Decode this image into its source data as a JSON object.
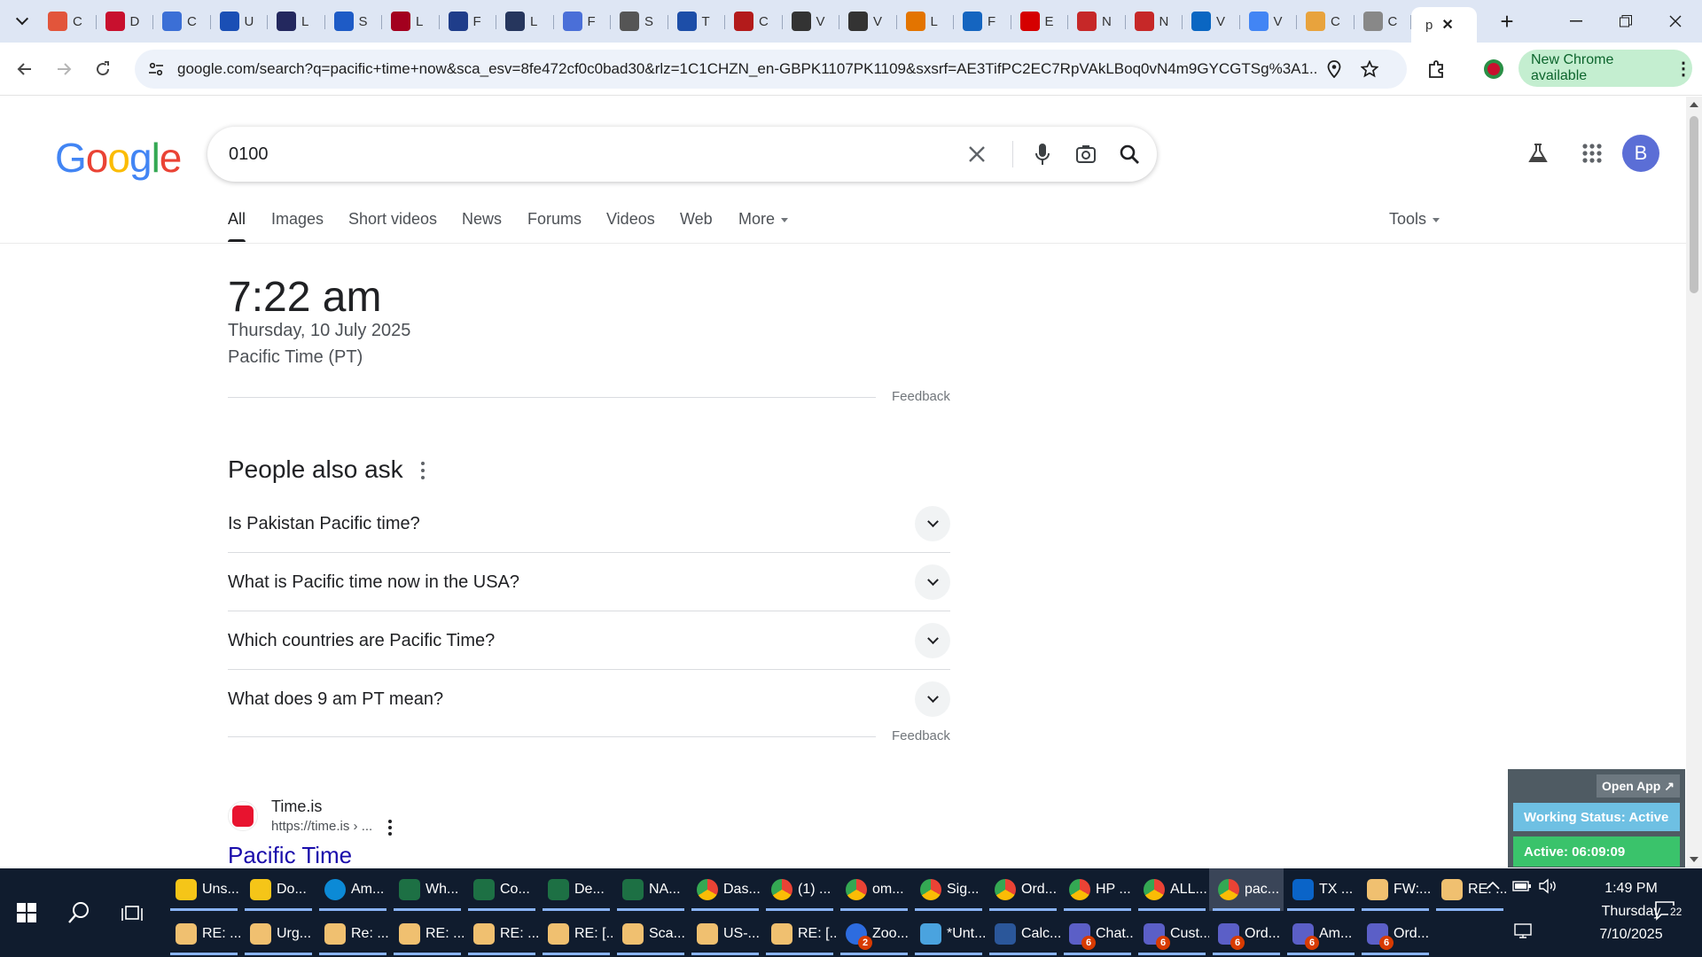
{
  "browser": {
    "tabs": [
      {
        "letter": "C",
        "color": "#e2553b"
      },
      {
        "letter": "D",
        "color": "#c8102e"
      },
      {
        "letter": "C",
        "color": "#3b6fd6"
      },
      {
        "letter": "U",
        "color": "#1a4fb5"
      },
      {
        "letter": "L",
        "color": "#23285e"
      },
      {
        "letter": "S",
        "color": "#1e5bc6"
      },
      {
        "letter": "L",
        "color": "#a3001e"
      },
      {
        "letter": "F",
        "color": "#1f3d8a"
      },
      {
        "letter": "L",
        "color": "#26365d"
      },
      {
        "letter": "F",
        "color": "#4a6fd8"
      },
      {
        "letter": "S",
        "color": "#555"
      },
      {
        "letter": "T",
        "color": "#1d4ea8"
      },
      {
        "letter": "C",
        "color": "#b31b1b"
      },
      {
        "letter": "V",
        "color": "#333"
      },
      {
        "letter": "V",
        "color": "#333"
      },
      {
        "letter": "L",
        "color": "#e37400"
      },
      {
        "letter": "F",
        "color": "#1565c0"
      },
      {
        "letter": "E",
        "color": "#d50000"
      },
      {
        "letter": "N",
        "color": "#c62828"
      },
      {
        "letter": "N",
        "color": "#c62828"
      },
      {
        "letter": "V",
        "color": "#0a66c2"
      },
      {
        "letter": "V",
        "color": "#4285f4"
      },
      {
        "letter": "C",
        "color": "#e8a33d"
      },
      {
        "letter": "C",
        "color": "#888"
      }
    ],
    "active_tab": {
      "letter": "p",
      "close": "✕"
    },
    "new_tab": "+",
    "url": "google.com/search?q=pacific+time+now&sca_esv=8fe472cf0c0bad30&rlz=1C1CHZN_en-GBPK1107PK1109&sxsrf=AE3TifPC2EC7RpVAkLBoq0vN4m9GYCGTSg%3A1...",
    "update_label": "New Chrome available",
    "colors": {
      "tabstrip": "#dee6f4",
      "update_bg": "#c4eed0"
    }
  },
  "google": {
    "logo": [
      "G",
      "o",
      "o",
      "g",
      "l",
      "e"
    ],
    "logo_colors": [
      "#4285f4",
      "#ea4335",
      "#fbbc05",
      "#4285f4",
      "#34a853",
      "#ea4335"
    ],
    "query": "0100",
    "avatar_letter": "B",
    "nav": {
      "tabs": [
        "All",
        "Images",
        "Short videos",
        "News",
        "Forums",
        "Videos",
        "Web"
      ],
      "more": "More",
      "tools": "Tools"
    },
    "time_card": {
      "time": "7:22 am",
      "date": "Thursday, 10 July 2025",
      "zone": "Pacific Time (PT)",
      "feedback": "Feedback"
    },
    "paa": {
      "title": "People also ask",
      "questions": [
        "Is Pakistan Pacific time?",
        "What is Pacific time now in the USA?",
        "Which countries are Pacific Time?",
        "What does 9 am PT mean?"
      ],
      "feedback": "Feedback"
    },
    "result": {
      "site": "Time.is",
      "url": "https://time.is › ...",
      "title": "Pacific Time"
    }
  },
  "widget": {
    "open_app": "Open App ↗",
    "status": "Working Status: Active",
    "active": "Active: 06:09:09"
  },
  "taskbar": {
    "row1": [
      {
        "label": "Uns...",
        "color": "#f5c518",
        "icon": "folder"
      },
      {
        "label": "Do...",
        "color": "#f5c518",
        "icon": "folder"
      },
      {
        "label": "Am...",
        "color": "#0c8ad6",
        "icon": "edge"
      },
      {
        "label": "Wh...",
        "color": "#1d7044",
        "icon": "X"
      },
      {
        "label": "Co...",
        "color": "#1d7044",
        "icon": "X"
      },
      {
        "label": "De...",
        "color": "#1d7044",
        "icon": "X"
      },
      {
        "label": "NA...",
        "color": "#1d7044",
        "icon": "X"
      },
      {
        "label": "Das...",
        "color": "#4285f4",
        "icon": "chrome"
      },
      {
        "label": "(1) ...",
        "color": "#4285f4",
        "icon": "chrome"
      },
      {
        "label": "om...",
        "color": "#4285f4",
        "icon": "chrome"
      },
      {
        "label": "Sig...",
        "color": "#4285f4",
        "icon": "chrome"
      },
      {
        "label": "Ord...",
        "color": "#4285f4",
        "icon": "chrome"
      },
      {
        "label": "HP ...",
        "color": "#4285f4",
        "icon": "chrome"
      },
      {
        "label": "ALL...",
        "color": "#4285f4",
        "icon": "chrome"
      },
      {
        "label": "pac...",
        "color": "#4285f4",
        "icon": "chrome"
      },
      {
        "label": "TX ...",
        "color": "#0a64c8",
        "icon": "O"
      },
      {
        "label": "FW:...",
        "color": "#f0c070",
        "icon": "mail"
      },
      {
        "label": "RE: ...",
        "color": "#f0c070",
        "icon": "mail"
      }
    ],
    "row2": [
      {
        "label": "RE: ...",
        "color": "#f0c070",
        "icon": "mail"
      },
      {
        "label": "Urg...",
        "color": "#f0c070",
        "icon": "mail"
      },
      {
        "label": "Re: ...",
        "color": "#f0c070",
        "icon": "mail"
      },
      {
        "label": "RE: ...",
        "color": "#f0c070",
        "icon": "mail"
      },
      {
        "label": "RE: ...",
        "color": "#f0c070",
        "icon": "mail"
      },
      {
        "label": "RE: [...",
        "color": "#f0c070",
        "icon": "mail"
      },
      {
        "label": "Sca...",
        "color": "#f0c070",
        "icon": "mail"
      },
      {
        "label": "US-...",
        "color": "#f0c070",
        "icon": "mail"
      },
      {
        "label": "RE: [...",
        "color": "#f0c070",
        "icon": "mail"
      },
      {
        "label": "Zoo...",
        "color": "#2d6cdf",
        "icon": "zoom",
        "badge": "2"
      },
      {
        "label": "*Unt...",
        "color": "#4aa3df",
        "icon": "note"
      },
      {
        "label": "Calc...",
        "color": "#2b579a",
        "icon": "calc"
      },
      {
        "label": "Chat...",
        "color": "#5b5fc7",
        "icon": "T",
        "badge": "6"
      },
      {
        "label": "Cust...",
        "color": "#5b5fc7",
        "icon": "T",
        "badge": "6"
      },
      {
        "label": "Ord...",
        "color": "#5b5fc7",
        "icon": "T",
        "badge": "6"
      },
      {
        "label": "Am...",
        "color": "#5b5fc7",
        "icon": "T",
        "badge": "6"
      },
      {
        "label": "Ord...",
        "color": "#5b5fc7",
        "icon": "T",
        "badge": "6"
      }
    ],
    "clock": {
      "time": "1:49 PM",
      "day": "Thursday",
      "date": "7/10/2025"
    },
    "notifications": "22"
  }
}
